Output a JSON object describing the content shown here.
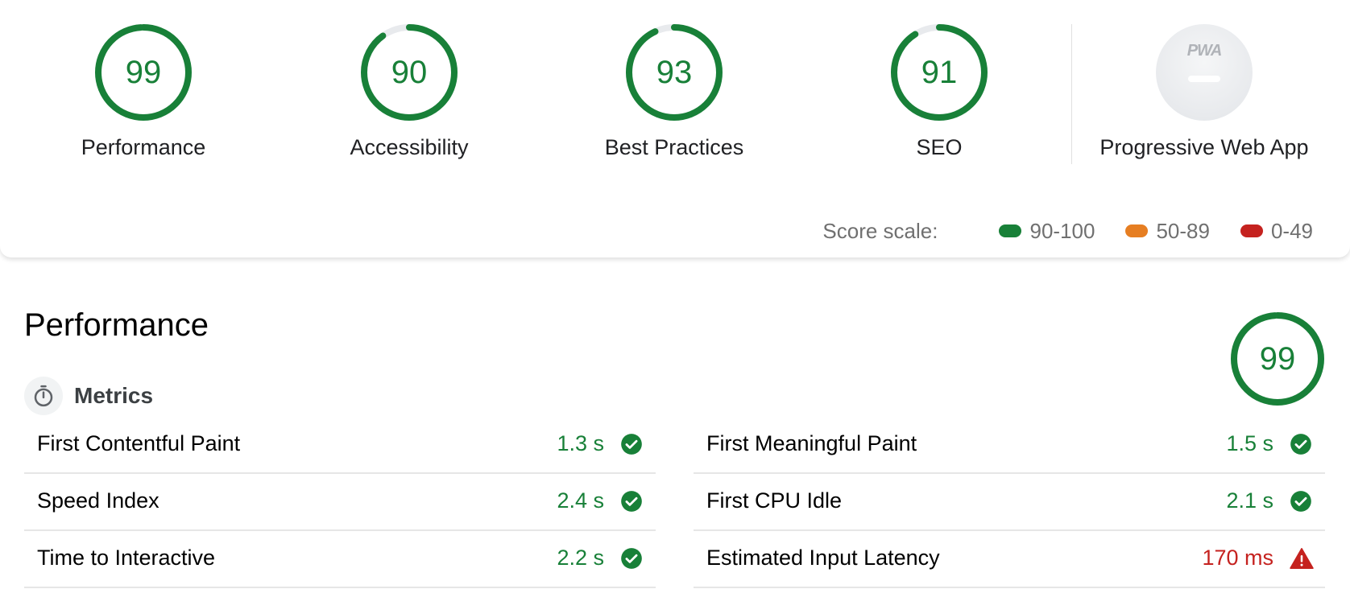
{
  "colors": {
    "pass": "#188038",
    "average": "#e67700",
    "fail": "#c5221f",
    "ring_track": "#e8eaed"
  },
  "categories": [
    {
      "score": "99",
      "score_value": 99,
      "label": "Performance"
    },
    {
      "score": "90",
      "score_value": 90,
      "label": "Accessibility"
    },
    {
      "score": "93",
      "score_value": 93,
      "label": "Best Practices"
    },
    {
      "score": "91",
      "score_value": 91,
      "label": "SEO"
    }
  ],
  "pwa": {
    "badge_text": "PWA",
    "label": "Progressive Web App"
  },
  "score_scale": {
    "title": "Score scale:",
    "ranges": [
      {
        "label": "90-100",
        "color": "#188038"
      },
      {
        "label": "50-89",
        "color": "#e67e22"
      },
      {
        "label": "0-49",
        "color": "#c5221f"
      }
    ]
  },
  "performance": {
    "title": "Performance",
    "score": "99",
    "score_value": 99,
    "metrics_title": "Metrics",
    "metrics_icon": "stopwatch-icon",
    "metrics_left": [
      {
        "label": "First Contentful Paint",
        "value": "1.3 s",
        "status": "pass",
        "icon": "check-circle-icon"
      },
      {
        "label": "Speed Index",
        "value": "2.4 s",
        "status": "pass",
        "icon": "check-circle-icon"
      },
      {
        "label": "Time to Interactive",
        "value": "2.2 s",
        "status": "pass",
        "icon": "check-circle-icon"
      }
    ],
    "metrics_right": [
      {
        "label": "First Meaningful Paint",
        "value": "1.5 s",
        "status": "pass",
        "icon": "check-circle-icon"
      },
      {
        "label": "First CPU Idle",
        "value": "2.1 s",
        "status": "pass",
        "icon": "check-circle-icon"
      },
      {
        "label": "Estimated Input Latency",
        "value": "170 ms",
        "status": "fail",
        "icon": "warning-triangle-icon"
      }
    ]
  }
}
